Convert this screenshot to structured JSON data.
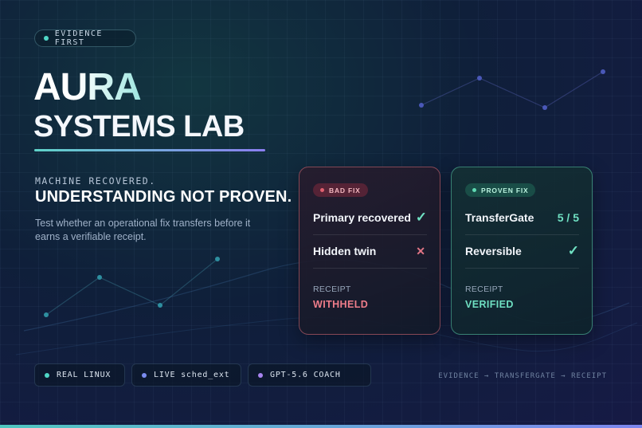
{
  "eyebrow": {
    "label": "EVIDENCE FIRST",
    "dot_color": "#4fd6c6"
  },
  "title": {
    "line1": "AURA",
    "line2": "SYSTEMS LAB"
  },
  "tagline": {
    "kicker": "MACHINE RECOVERED.",
    "headline": "UNDERSTANDING NOT PROVEN.",
    "description": "Test whether an operational fix transfers before it earns a verifiable receipt."
  },
  "cards": {
    "bad": {
      "badge": "BAD FIX",
      "rows": [
        {
          "label": "Primary recovered",
          "mark": "✓"
        },
        {
          "label": "Hidden twin",
          "mark": "✕"
        }
      ],
      "receipt_label": "RECEIPT",
      "receipt_value": "WITHHELD"
    },
    "good": {
      "badge": "PROVEN FIX",
      "rows": [
        {
          "label": "TransferGate",
          "mark": "5 / 5"
        },
        {
          "label": "Reversible",
          "mark": "✓"
        }
      ],
      "receipt_label": "RECEIPT",
      "receipt_value": "VERIFIED"
    }
  },
  "chips": [
    {
      "label": "REAL LINUX",
      "dot_color": "#4fd6c6"
    },
    {
      "label": "LIVE sched_ext",
      "dot_color": "#7b8cf0"
    },
    {
      "label": "GPT-5.6 COACH",
      "dot_color": "#a884f0"
    }
  ],
  "flow": "EVIDENCE → TRANSFERGATE → RECEIPT",
  "colors": {
    "accent_teal": "#6fe0c2",
    "accent_red": "#ef7d8a",
    "accent_violet": "#8a7ef0"
  }
}
